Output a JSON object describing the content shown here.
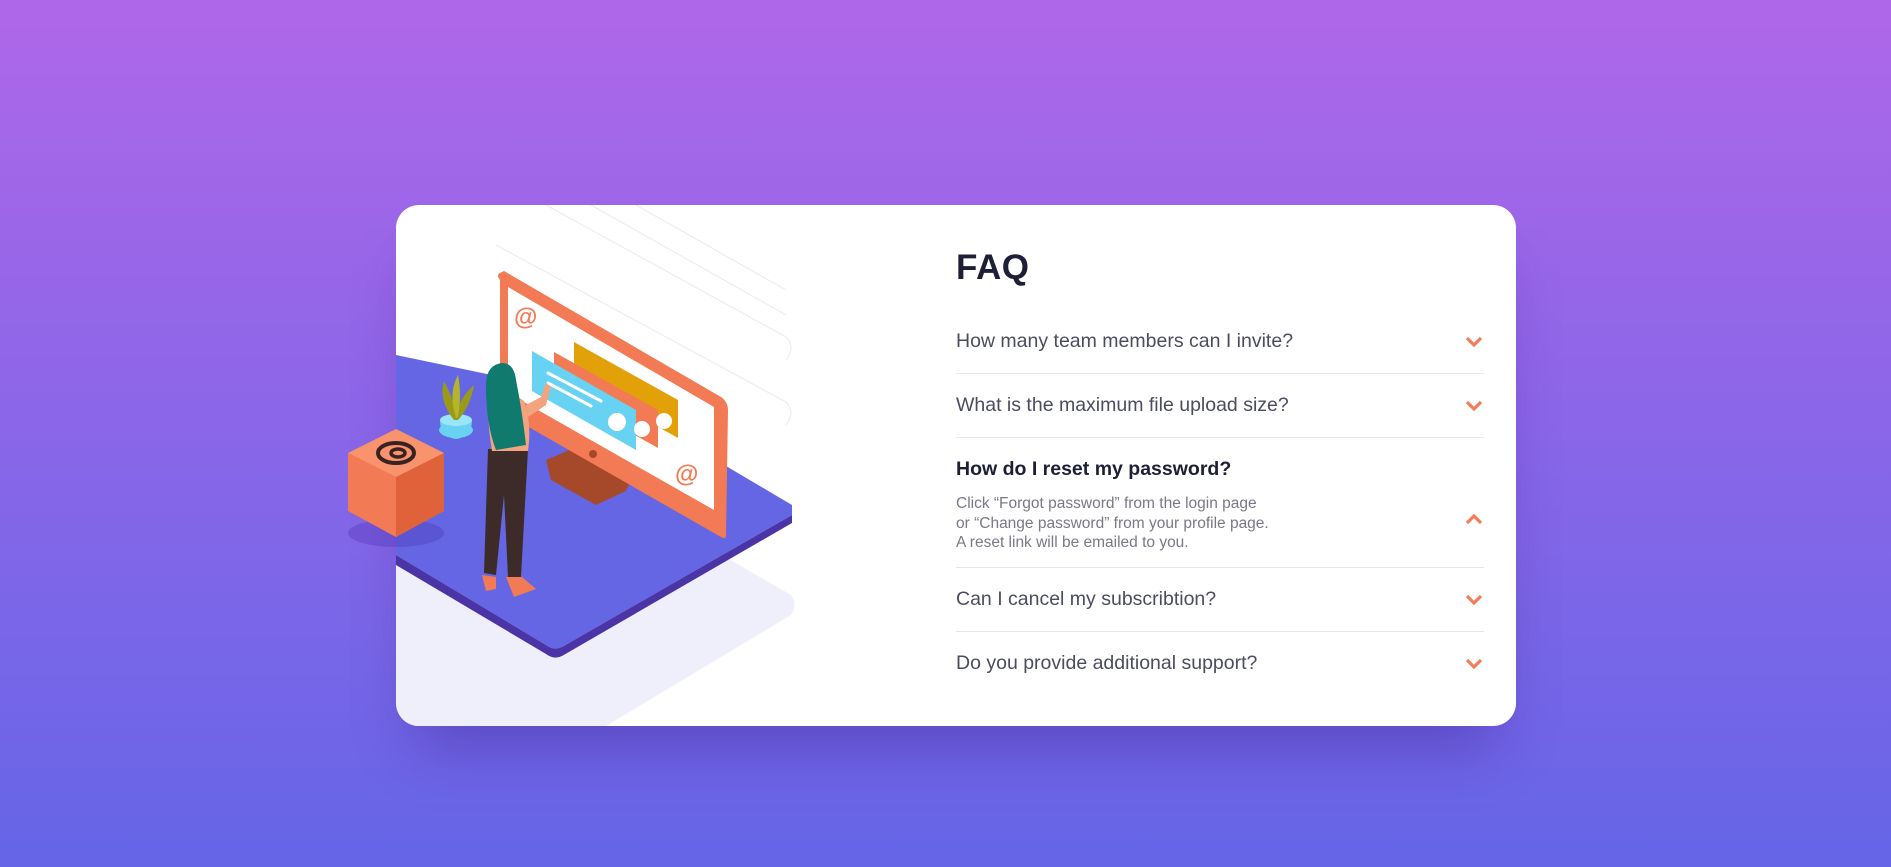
{
  "colors": {
    "gradient_top": "#af67e9",
    "gradient_bottom": "#6565e7",
    "accent": "#f47c57",
    "title": "#1e1f36",
    "text": "#4b4c5f",
    "muted": "#787887"
  },
  "faq": {
    "title": "FAQ",
    "items": [
      {
        "question": "How many team members can I invite?",
        "answer": "",
        "open": false,
        "icon": "chevron-down-icon"
      },
      {
        "question": "What is the maximum file upload size?",
        "answer": "",
        "open": false,
        "icon": "chevron-down-icon"
      },
      {
        "question": "How do I reset my password?",
        "answer_lines": [
          "Click “Forgot password” from the login page",
          "or “Change password” from your profile page.",
          "A reset link will be emailed to you."
        ],
        "open": true,
        "icon": "chevron-up-icon"
      },
      {
        "question": "Can I cancel my subscribtion?",
        "answer": "",
        "open": false,
        "icon": "chevron-down-icon"
      },
      {
        "question": "Do you provide additional support?",
        "answer": "",
        "open": false,
        "icon": "chevron-down-icon"
      }
    ]
  },
  "illustration": {
    "name": "woman-online-desktop-illustration",
    "box_icon": "at-sign-icon"
  }
}
